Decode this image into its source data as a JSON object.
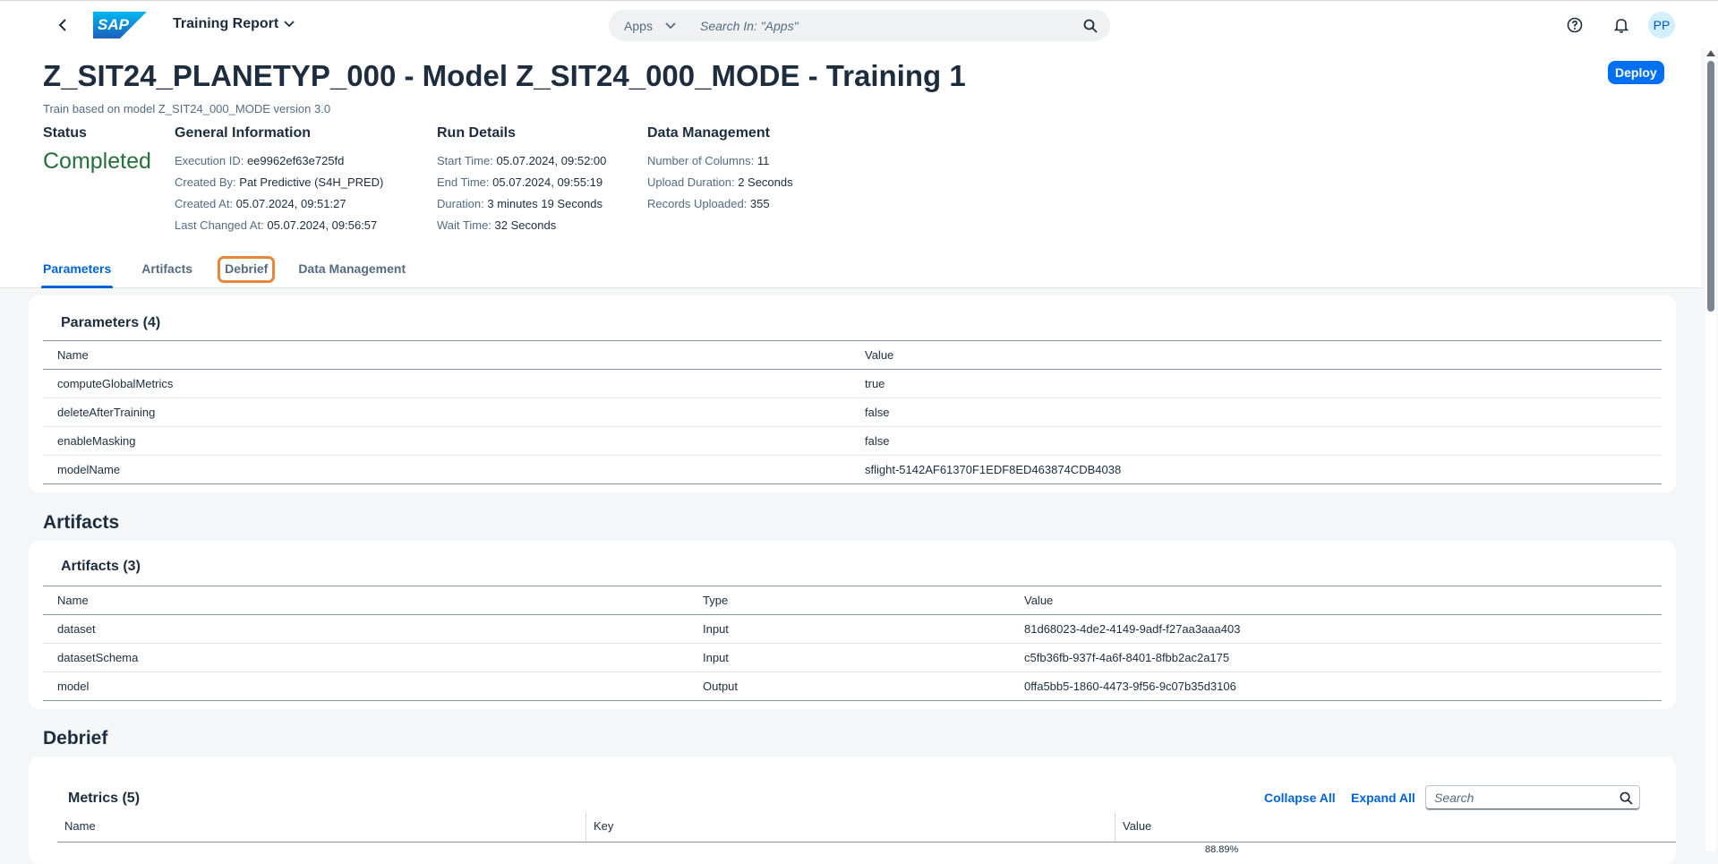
{
  "shell": {
    "app_title": "Training Report",
    "search_scope": "Apps",
    "search_placeholder": "Search In: \"Apps\"",
    "avatar_initials": "PP",
    "logo_text": "SAP"
  },
  "header": {
    "title": "Z_SIT24_PLANETYP_000 - Model Z_SIT24_000_MODE - Training 1",
    "subtitle": "Train based on model Z_SIT24_000_MODE version 3.0",
    "deploy_label": "Deploy",
    "status": {
      "heading": "Status",
      "value": "Completed"
    },
    "general": {
      "heading": "General Information",
      "items": [
        {
          "label": "Execution ID:",
          "value": "ee9962ef63e725fd"
        },
        {
          "label": "Created By:",
          "value": "Pat Predictive (S4H_PRED)"
        },
        {
          "label": "Created At:",
          "value": "05.07.2024, 09:51:27"
        },
        {
          "label": "Last Changed At:",
          "value": "05.07.2024, 09:56:57"
        }
      ]
    },
    "run": {
      "heading": "Run Details",
      "items": [
        {
          "label": "Start Time:",
          "value": "05.07.2024, 09:52:00"
        },
        {
          "label": "End Time:",
          "value": "05.07.2024, 09:55:19"
        },
        {
          "label": "Duration:",
          "value": "3 minutes 19 Seconds"
        },
        {
          "label": "Wait Time:",
          "value": "32 Seconds"
        }
      ]
    },
    "datamgmt": {
      "heading": "Data Management",
      "items": [
        {
          "label": "Number of Columns:",
          "value": "11"
        },
        {
          "label": "Upload Duration:",
          "value": "2 Seconds"
        },
        {
          "label": "Records Uploaded:",
          "value": "355"
        }
      ]
    },
    "tabs": [
      "Parameters",
      "Artifacts",
      "Debrief",
      "Data Management"
    ]
  },
  "parameters": {
    "card_title": "Parameters (4)",
    "columns": [
      "Name",
      "Value"
    ],
    "rows": [
      [
        "computeGlobalMetrics",
        "true"
      ],
      [
        "deleteAfterTraining",
        "false"
      ],
      [
        "enableMasking",
        "false"
      ],
      [
        "modelName",
        "sflight-5142AF61370F1EDF8ED463874CDB4038"
      ]
    ]
  },
  "artifacts": {
    "section_title": "Artifacts",
    "card_title": "Artifacts (3)",
    "columns": [
      "Name",
      "Type",
      "Value"
    ],
    "rows": [
      [
        "dataset",
        "Input",
        "81d68023-4de2-4149-9adf-f27aa3aaa403"
      ],
      [
        "datasetSchema",
        "Input",
        "c5fb36fb-937f-4a6f-8401-8fbb2ac2a175"
      ],
      [
        "model",
        "Output",
        "0ffa5bb5-1860-4473-9f56-9c07b35d3106"
      ]
    ]
  },
  "debrief": {
    "section_title": "Debrief",
    "card_title": "Metrics (5)",
    "collapse_all": "Collapse All",
    "expand_all": "Expand All",
    "search_placeholder": "Search",
    "columns": [
      "Name",
      "Key",
      "Value"
    ],
    "partial_value": "88.89%"
  }
}
